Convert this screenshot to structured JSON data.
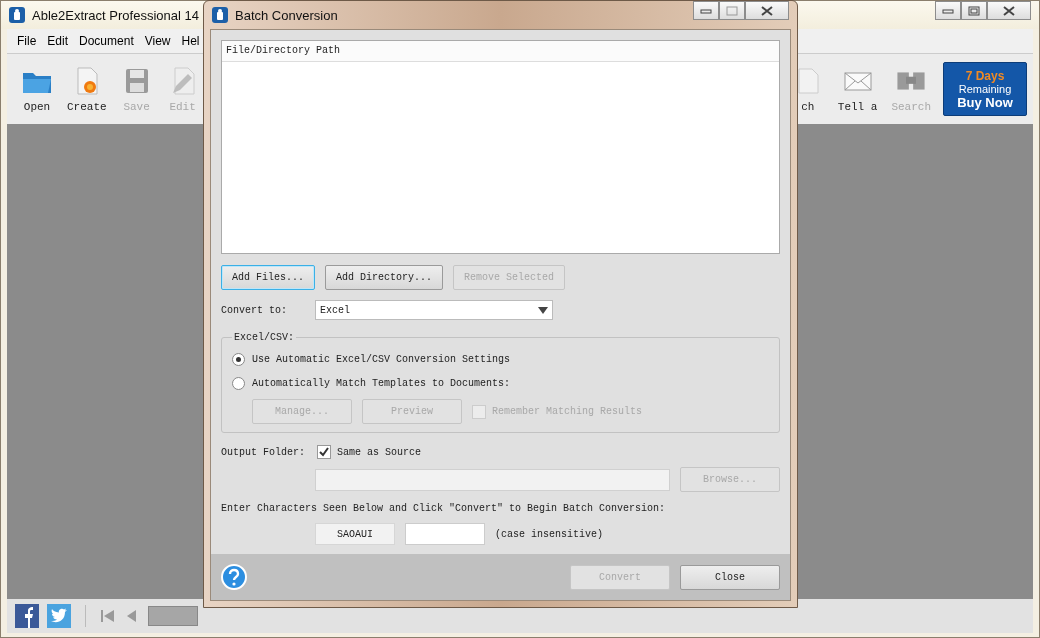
{
  "app": {
    "title": "Able2Extract Professional 14"
  },
  "menu": [
    "File",
    "Edit",
    "Document",
    "View",
    "Hel"
  ],
  "toolbar_left": [
    {
      "label": "Open",
      "kind": "folder",
      "disabled": false
    },
    {
      "label": "Create",
      "kind": "create",
      "disabled": false
    },
    {
      "label": "Save",
      "kind": "save",
      "disabled": true
    },
    {
      "label": "Edit",
      "kind": "edit",
      "disabled": true
    }
  ],
  "toolbar_right": [
    {
      "label": "ch",
      "kind": "doc",
      "disabled": false
    },
    {
      "label": "Tell a",
      "kind": "mail",
      "disabled": false
    },
    {
      "label": "Search",
      "kind": "binoculars",
      "disabled": true
    }
  ],
  "trial": {
    "days": "7 Days",
    "remaining": "Remaining",
    "action": "Buy Now"
  },
  "dialog": {
    "title": "Batch Conversion",
    "list_header": "File/Directory Path",
    "list_buttons": [
      {
        "label": "Add Files...",
        "disabled": false,
        "focused": true
      },
      {
        "label": "Add Directory...",
        "disabled": false,
        "focused": false
      },
      {
        "label": "Remove Selected",
        "disabled": true,
        "focused": false
      }
    ],
    "convert_to": {
      "label": "Convert to:",
      "value": "Excel"
    },
    "group": {
      "title": "Excel/CSV:",
      "options": [
        {
          "label": "Use Automatic Excel/CSV Conversion Settings",
          "selected": true
        },
        {
          "label": "Automatically Match Templates to Documents:",
          "selected": false
        }
      ],
      "buttons": [
        {
          "label": "Manage...",
          "disabled": true
        },
        {
          "label": "Preview",
          "disabled": true
        }
      ],
      "remember": {
        "label": "Remember Matching Results",
        "checked": false,
        "disabled": true
      }
    },
    "output": {
      "label": "Output Folder:",
      "same_as_source": {
        "label": "Same as Source",
        "checked": true
      },
      "browse": {
        "label": "Browse...",
        "disabled": true
      }
    },
    "captcha": {
      "instruction": "Enter Characters Seen Below and Click \"Convert\" to Begin Batch Conversion:",
      "code": "SAOAUI",
      "hint": "(case insensitive)"
    },
    "footer_buttons": [
      {
        "label": "Convert",
        "disabled": true
      },
      {
        "label": "Close",
        "disabled": false
      }
    ]
  }
}
